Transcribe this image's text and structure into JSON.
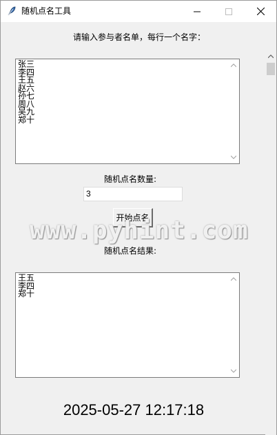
{
  "window": {
    "title": "随机点名工具",
    "icon": "feather-icon"
  },
  "titlebar_buttons": {
    "minimize": "minimize-icon",
    "maximize": "maximize-icon",
    "close": "close-icon"
  },
  "form": {
    "names_prompt": "请输入参与者名单，每行一个名字：",
    "names_list": [
      "张三",
      "李四",
      "王五",
      "赵六",
      "孙七",
      "周八",
      "吴九",
      "郑十"
    ],
    "count_label": "随机点名数量:",
    "count_value": "3",
    "start_button": "开始点名",
    "result_label": "随机点名结果:",
    "result_list": [
      "王五",
      "李四",
      "郑十"
    ]
  },
  "watermark": "www.pyhint.com",
  "clock": "2025-05-27 12:17:18"
}
